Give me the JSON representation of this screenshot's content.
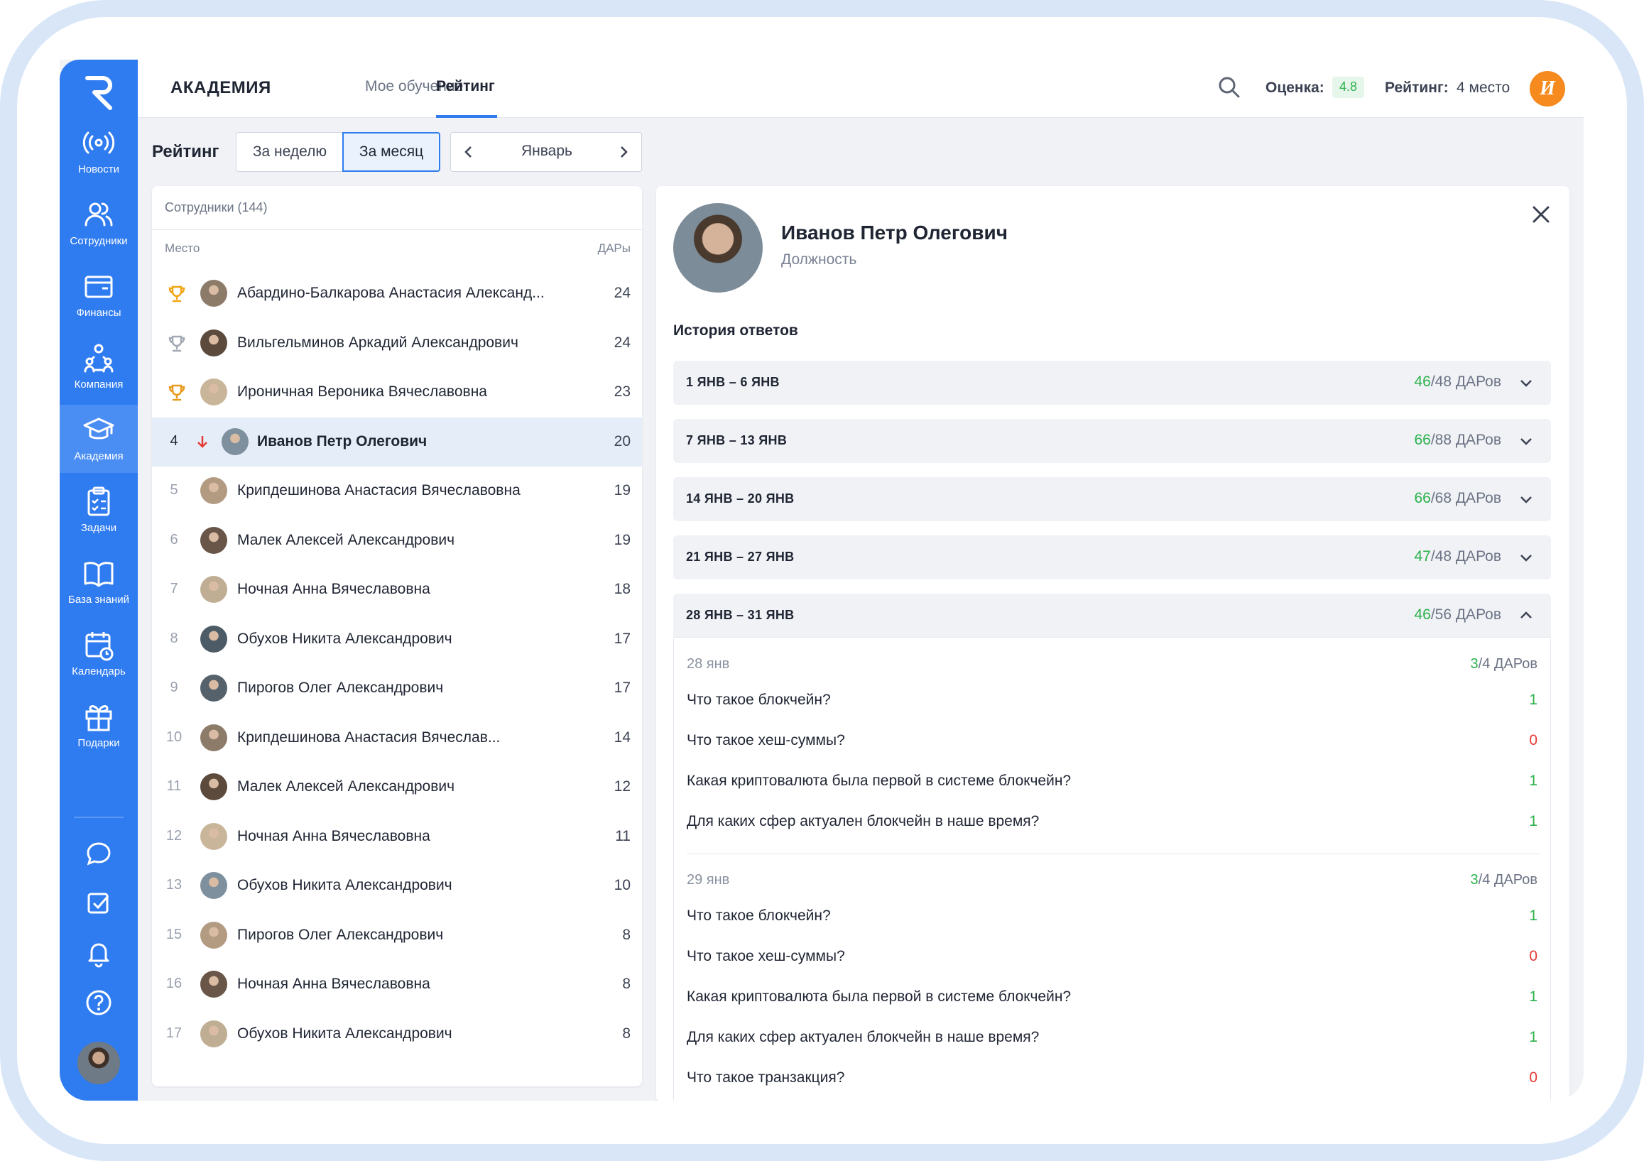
{
  "brand": "АКАДЕМИЯ",
  "tabs": [
    "Мое обучение",
    "Рейтинг"
  ],
  "header": {
    "score_label": "Оценка:",
    "score_value": "4.8",
    "rating_label": "Рейтинг:",
    "rating_value": "4 место",
    "user_initial": "И"
  },
  "sidebar": {
    "items": [
      {
        "label": "Новости",
        "icon": "broadcast-icon"
      },
      {
        "label": "Сотрудники",
        "icon": "users-icon"
      },
      {
        "label": "Финансы",
        "icon": "wallet-icon"
      },
      {
        "label": "Компания",
        "icon": "company-icon"
      },
      {
        "label": "Академия",
        "icon": "graduation-cap-icon"
      },
      {
        "label": "Задачи",
        "icon": "clipboard-icon"
      },
      {
        "label": "База знаний",
        "icon": "book-icon"
      },
      {
        "label": "Календарь",
        "icon": "calendar-icon"
      },
      {
        "label": "Подарки",
        "icon": "gift-icon"
      }
    ],
    "active": "Академия"
  },
  "filters": {
    "title": "Рейтинг",
    "week": "За неделю",
    "month": "За месяц",
    "current_month": "Январь"
  },
  "employees": {
    "header": "Сотрудники (144)",
    "col_place": "Место",
    "col_points": "ДАРы",
    "rows": [
      {
        "rank": "",
        "trophy": "gold",
        "name": "Абардино-Балкарова Анастасия Александ...",
        "points": "24"
      },
      {
        "rank": "",
        "trophy": "silver",
        "name": "Вильгельминов Аркадий Александрович",
        "points": "24"
      },
      {
        "rank": "",
        "trophy": "bronze",
        "name": "Ироничная Вероника Вячеславовна",
        "points": "23"
      },
      {
        "rank": "4",
        "trophy": "",
        "name": "Иванов Петр Олегович",
        "points": "20",
        "active": true
      },
      {
        "rank": "5",
        "name": "Крипдешинова Анастасия Вячеславовна",
        "points": "19"
      },
      {
        "rank": "6",
        "name": "Малек Алексей Александрович",
        "points": "19"
      },
      {
        "rank": "7",
        "name": "Ночная Анна Вячеславовна",
        "points": "18"
      },
      {
        "rank": "8",
        "name": "Обухов Никита Александрович",
        "points": "17"
      },
      {
        "rank": "9",
        "name": "Пирогов Олег Александрович",
        "points": "17"
      },
      {
        "rank": "10",
        "name": "Крипдешинова Анастасия Вячеслав...",
        "points": "14"
      },
      {
        "rank": "11",
        "name": "Малек Алексей Александрович",
        "points": "12"
      },
      {
        "rank": "12",
        "name": "Ночная Анна Вячеславовна",
        "points": "11"
      },
      {
        "rank": "13",
        "name": "Обухов Никита Александрович",
        "points": "10"
      },
      {
        "rank": "15",
        "name": "Пирогов Олег Александрович",
        "points": "8"
      },
      {
        "rank": "16",
        "name": "Ночная Анна Вячеславовна",
        "points": "8"
      },
      {
        "rank": "17",
        "name": "Обухов Никита Александрович",
        "points": "8"
      }
    ]
  },
  "profile": {
    "name": "Иванов Петр Олегович",
    "position": "Должность",
    "history_title": "История ответов"
  },
  "weeks": [
    {
      "label": "1 ЯНВ – 6 ЯНВ",
      "got": "46",
      "total": "/48 ДАРов"
    },
    {
      "label": "7 ЯНВ – 13 ЯНВ",
      "got": "66",
      "total": "/88 ДАРов"
    },
    {
      "label": "14 ЯНВ – 20 ЯНВ",
      "got": "66",
      "total": "/68 ДАРов"
    },
    {
      "label": "21 ЯНВ – 27 ЯНВ",
      "got": "47",
      "total": "/48 ДАРов"
    },
    {
      "label": "28 ЯНВ – 31 ЯНВ",
      "got": "46",
      "total": "/56 ДАРов"
    }
  ],
  "days": [
    {
      "date": "28 янв",
      "got": "3",
      "total": "/4 ДАРов",
      "questions": [
        {
          "q": "Что такое блокчейн?",
          "s": "1"
        },
        {
          "q": "Что такое хеш-суммы?",
          "s": "0"
        },
        {
          "q": "Какая криптовалюта была первой в системе блокчейн?",
          "s": "1"
        },
        {
          "q": "Для каких сфер актуален блокчейн в наше время?",
          "s": "1"
        }
      ]
    },
    {
      "date": "29 янв",
      "got": "3",
      "total": "/4 ДАРов",
      "questions": [
        {
          "q": "Что такое блокчейн?",
          "s": "1"
        },
        {
          "q": "Что такое хеш-суммы?",
          "s": "0"
        },
        {
          "q": "Какая криптовалюта была первой в системе блокчейн?",
          "s": "1"
        },
        {
          "q": "Для каких сфер актуален блокчейн в наше время?",
          "s": "1"
        },
        {
          "q": "Что такое транзакция?",
          "s": "0"
        }
      ]
    }
  ],
  "colors": {
    "accent": "#2f7bf0",
    "success": "#2bb14c",
    "danger": "#e53935",
    "orange": "#f68a1f"
  }
}
